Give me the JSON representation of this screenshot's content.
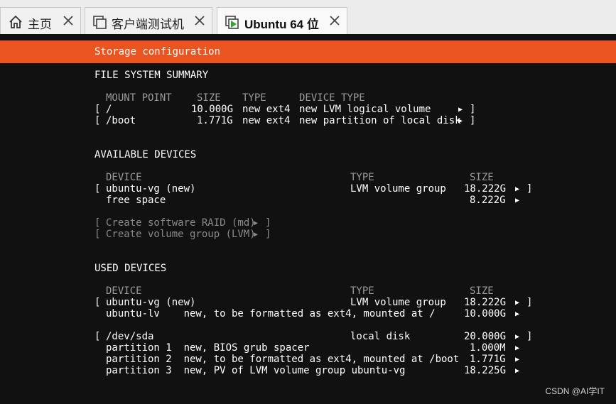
{
  "tabs": [
    {
      "label": "主页"
    },
    {
      "label": "客户端测试机"
    },
    {
      "label": "Ubuntu 64 位"
    }
  ],
  "header": {
    "title": "Storage configuration"
  },
  "fs_summary": {
    "title": "FILE SYSTEM SUMMARY",
    "columns": {
      "mount": "MOUNT POINT",
      "size": "SIZE",
      "type": "TYPE",
      "device_type": "DEVICE TYPE"
    },
    "rows": [
      {
        "mount": "/",
        "size": "10.000G",
        "type": "new ext4",
        "device_type": "new LVM logical volume"
      },
      {
        "mount": "/boot",
        "size": "1.771G",
        "type": "new ext4",
        "device_type": "new partition of local disk"
      }
    ]
  },
  "available": {
    "title": "AVAILABLE DEVICES",
    "columns": {
      "device": "DEVICE",
      "type": "TYPE",
      "size": "SIZE"
    },
    "rows": [
      {
        "device": "ubuntu-vg (new)",
        "type": "LVM volume group",
        "size": "18.222G"
      },
      {
        "device": "free space",
        "type": "",
        "size": "8.222G"
      }
    ],
    "actions": [
      "Create software RAID (md)",
      "Create volume group (LVM)"
    ]
  },
  "used": {
    "title": "USED DEVICES",
    "columns": {
      "device": "DEVICE",
      "type": "TYPE",
      "size": "SIZE"
    },
    "rows": [
      {
        "device": "ubuntu-vg (new)",
        "type": "LVM volume group",
        "size": "18.222G"
      },
      {
        "device": "ubuntu-lv    new, to be formatted as ext4, mounted at /",
        "type": "",
        "size": "10.000G"
      },
      {
        "device": "/dev/sda",
        "type": "local disk",
        "size": "20.000G"
      },
      {
        "device": "partition 1  new, BIOS grub spacer",
        "type": "",
        "size": "1.000M"
      },
      {
        "device": "partition 2  new, to be formatted as ext4, mounted at /boot",
        "type": "",
        "size": "1.771G"
      },
      {
        "device": "partition 3  new, PV of LVM volume group ubuntu-vg",
        "type": "",
        "size": "18.225G"
      }
    ]
  },
  "watermark": "CSDN @AI学IT"
}
